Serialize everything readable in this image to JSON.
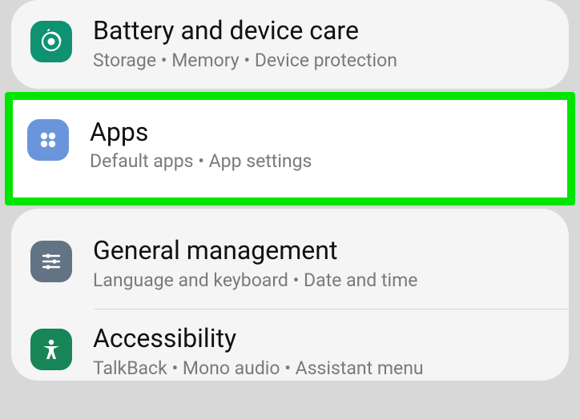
{
  "settings": {
    "battery": {
      "title": "Battery and device care",
      "subtitle": "Storage  •  Memory  •  Device protection"
    },
    "apps": {
      "title": "Apps",
      "subtitle": "Default apps  •  App settings"
    },
    "general": {
      "title": "General management",
      "subtitle": "Language and keyboard  •  Date and time"
    },
    "accessibility": {
      "title": "Accessibility",
      "subtitle": "TalkBack  •  Mono audio  •  Assistant menu"
    }
  }
}
